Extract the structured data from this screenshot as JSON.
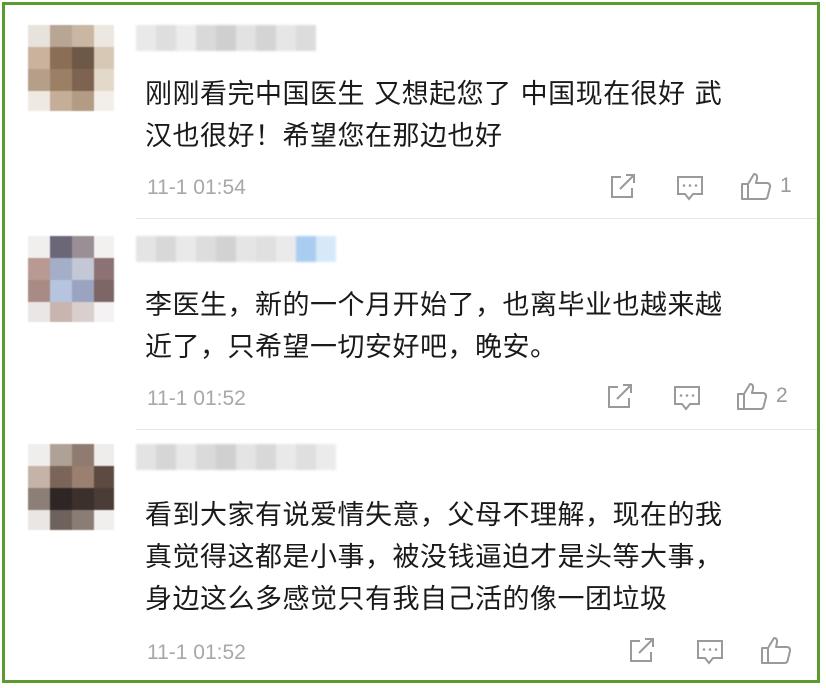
{
  "comments": [
    {
      "text": "刚刚看完中国医生 又想起您了 中国现在很好 武\n汉也很好！希望您在那边也好",
      "time": "11-1 01:54",
      "likes": "1"
    },
    {
      "text": "李医生，新的一个月开始了，也离毕业也越来越\n近了，只希望一切安好吧，晚安。",
      "time": "11-1 01:52",
      "likes": "2"
    },
    {
      "text": "看到大家有说爱情失意，父母不理解，现在的我\n真觉得这都是小事，被没钱逼迫才是头等大事，\n身边这么多感觉只有我自己活的像一团垃圾",
      "time": "11-1 01:52",
      "likes": ""
    }
  ],
  "icons": {
    "share": "share-icon",
    "reply": "comment-icon",
    "like": "thumbs-up-icon"
  },
  "colors": {
    "frame_border": "#5b9a2c",
    "text": "#1a1a1a",
    "meta": "#a8a8a8",
    "icon": "#9a9a9a",
    "divider": "#e6e6e6"
  }
}
